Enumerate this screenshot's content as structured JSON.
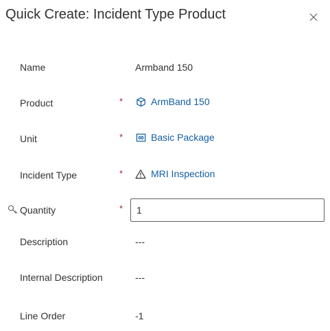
{
  "dialog": {
    "title": "Quick Create: Incident Type Product"
  },
  "fields": {
    "name": {
      "label": "Name",
      "value": "Armband 150"
    },
    "product": {
      "label": "Product",
      "required_mark": "*",
      "value": "ArmBand 150",
      "icon": "cube-icon"
    },
    "unit": {
      "label": "Unit",
      "required_mark": "*",
      "value": "Basic Package",
      "icon": "package-icon"
    },
    "incident_type": {
      "label": "Incident Type",
      "required_mark": "*",
      "value": "MRI Inspection",
      "icon": "warning-icon"
    },
    "quantity": {
      "label": "Quantity",
      "required_mark": "*",
      "value": "1",
      "icon": "lock-icon"
    },
    "description": {
      "label": "Description",
      "value": "---"
    },
    "internal_description": {
      "label": "Internal Description",
      "value": "---"
    },
    "line_order": {
      "label": "Line Order",
      "value": "-1"
    }
  },
  "colors": {
    "link": "#115ea3",
    "required": "#a4262c",
    "text": "#323130"
  }
}
